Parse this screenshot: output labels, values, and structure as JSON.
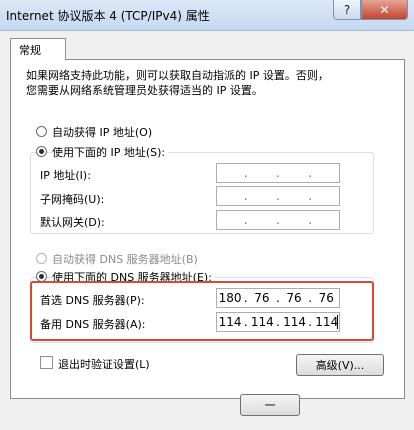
{
  "window": {
    "title": "Internet 协议版本 4 (TCP/IPv4) 属性",
    "help_icon": "?",
    "close_icon": "✕"
  },
  "tabs": [
    {
      "label": "常规"
    }
  ],
  "description": {
    "line1": "如果网络支持此功能，则可以获取自动指派的 IP 设置。否则，",
    "line2": "您需要从网络系统管理员处获得适当的 IP 设置。"
  },
  "ip_section": {
    "auto_label": "自动获得 IP 地址(O)",
    "manual_label": "使用下面的 IP 地址(S):",
    "selected": "manual",
    "fields": [
      {
        "label": "IP 地址(I):",
        "octets": [
          "",
          "",
          "",
          ""
        ]
      },
      {
        "label": "子网掩码(U):",
        "octets": [
          "",
          "",
          "",
          ""
        ]
      },
      {
        "label": "默认网关(D):",
        "octets": [
          "",
          "",
          "",
          ""
        ]
      }
    ]
  },
  "dns_section": {
    "auto_label": "自动获得 DNS 服务器地址(B)",
    "manual_label": "使用下面的 DNS 服务器地址(E):",
    "selected": "manual",
    "preferred": {
      "label": "首选 DNS 服务器(P):",
      "octets": [
        "180",
        "76",
        "76",
        "76"
      ]
    },
    "alternate": {
      "label": "备用 DNS 服务器(A):",
      "octets": [
        "114",
        "114",
        "114",
        "114"
      ]
    }
  },
  "validate": {
    "label": "退出时验证设置(L)",
    "checked": false
  },
  "advanced_button": "高级(V)...",
  "ok_button_partial": "一",
  "colors": {
    "highlight": "#d8473b",
    "title_bg": "#c7d9ef"
  }
}
